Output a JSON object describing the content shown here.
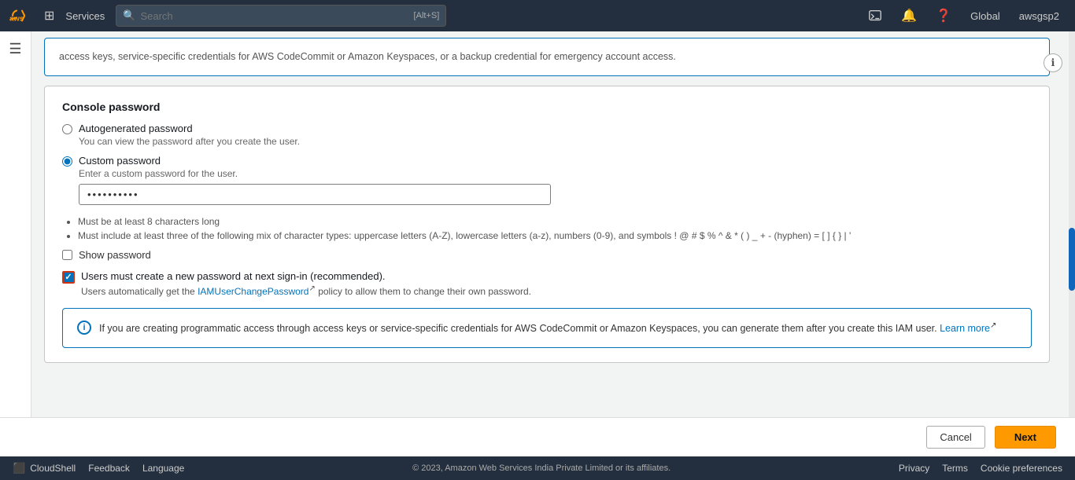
{
  "topNav": {
    "services_label": "Services",
    "search_placeholder": "Search",
    "search_shortcut": "[Alt+S]",
    "global_label": "Global",
    "user_label": "awsgsp2"
  },
  "content": {
    "top_partial_text": "access keys, service-specific credentials for AWS CodeCommit or Amazon Keyspaces, or a backup credential for emergency account access.",
    "section_title": "Console password",
    "autogenerated_label": "Autogenerated password",
    "autogenerated_sub": "You can view the password after you create the user.",
    "custom_label": "Custom password",
    "custom_sub": "Enter a custom password for the user.",
    "password_value": "••••••••••",
    "req1": "Must be at least 8 characters long",
    "req2": "Must include at least three of the following mix of character types: uppercase letters (A-Z), lowercase letters (a-z), numbers (0-9), and symbols ! @ # $ % ^ & * ( ) _ + - (hyphen) = [ ] { } | '",
    "show_password_label": "Show password",
    "must_change_label": "Users must create a new password at next sign-in (recommended).",
    "must_change_sub_prefix": "Users automatically get the ",
    "must_change_link": "IAMUserChangePassword",
    "must_change_sub_suffix": " policy to allow them to change their own password.",
    "info_text_prefix": "If you are creating programmatic access through access keys or service-specific credentials for AWS CodeCommit or Amazon Keyspaces, you can generate them after you create this IAM user. ",
    "info_learn_more": "Learn more",
    "info_icon_label": "i"
  },
  "bottomBar": {
    "cancel_label": "Cancel",
    "next_label": "Next"
  },
  "footer": {
    "cloudshell_label": "CloudShell",
    "feedback_label": "Feedback",
    "language_label": "Language",
    "copyright": "© 2023, Amazon Web Services India Private Limited or its affiliates.",
    "privacy_label": "Privacy",
    "terms_label": "Terms",
    "cookie_label": "Cookie preferences"
  }
}
